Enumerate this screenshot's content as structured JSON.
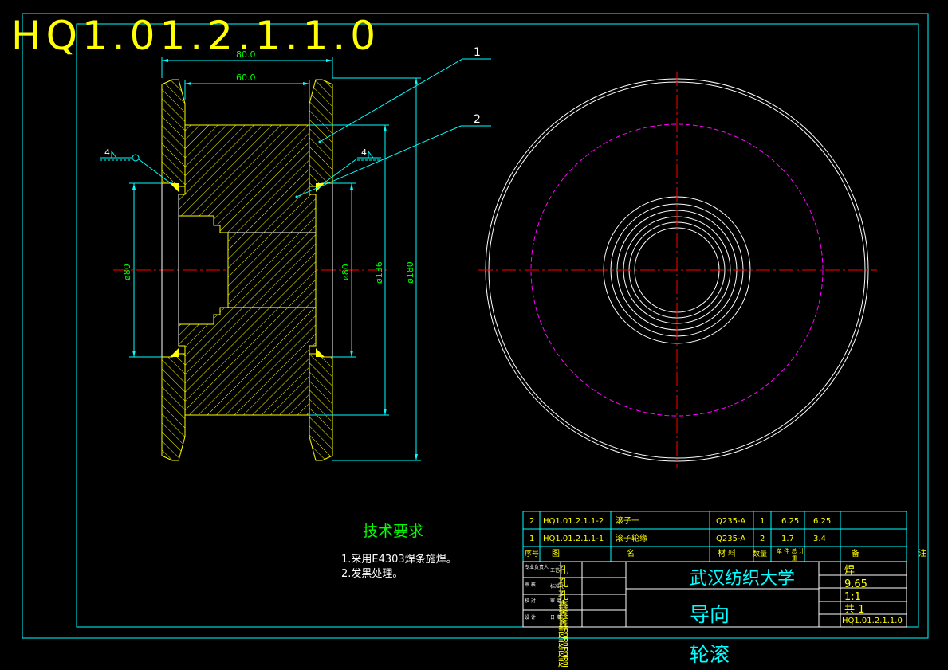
{
  "drawing_number": "HQ1.01.2.1.1.0",
  "dimensions": {
    "w_outer": "80.0",
    "w_inner": "60.0",
    "d_bore_left": "ø80",
    "d_bore_right": "ø80",
    "d_hub": "ø136",
    "d_outer": "ø180"
  },
  "weld_size_left": "4",
  "weld_size_right": "4",
  "balloons": [
    "1",
    "2"
  ],
  "tech_requirements": {
    "title": "技术要求",
    "items": [
      "1.采用E4303焊条施焊。",
      "2.发黑处理。"
    ]
  },
  "bom": {
    "rows": [
      {
        "seq": "2",
        "code": "HQ1.01.2.1.1-2",
        "name": "滚子一",
        "material": "Q235-A",
        "qty": "1",
        "unit_w": "6.25",
        "total_w": "6.25"
      },
      {
        "seq": "1",
        "code": "HQ1.01.2.1.1-1",
        "name": "滚子轮缘",
        "material": "Q235-A",
        "qty": "2",
        "unit_w": "1.7",
        "total_w": "3.4"
      }
    ],
    "header": {
      "seq": "序号",
      "code": "图",
      "name": "名",
      "material": "材 料",
      "qty": "数量",
      "weights": "单 件  总 计",
      "weight_sub": "重",
      "remark": "备",
      "note": "注"
    }
  },
  "title_block": {
    "roles": [
      "专业负责人",
      "审 核",
      "校 对",
      "设 计"
    ],
    "roles_col2": [
      "工艺",
      "标准化",
      "审 定",
      "日 期"
    ],
    "designer_column": [
      "孔",
      "孔",
      "孔",
      "鑫",
      "鑫",
      "鑫",
      "超",
      "超",
      "超",
      "超"
    ],
    "university": "武汉纺织大学",
    "part_name_1": "导向",
    "part_name_2": "轮滚",
    "stage": "焊",
    "weight": "9.65",
    "scale": "1:1",
    "sheet": "共 1",
    "number": "HQ1.01.2.1.1.0"
  },
  "colors": {
    "background": "#000000",
    "border": "#00ffff",
    "outline": "#ffffff",
    "hatch": "#ffff00",
    "centerline": "#ff0000",
    "pitch_circle": "#ff00ff",
    "dimension": "#00ff00",
    "leader": "#00ffff"
  }
}
